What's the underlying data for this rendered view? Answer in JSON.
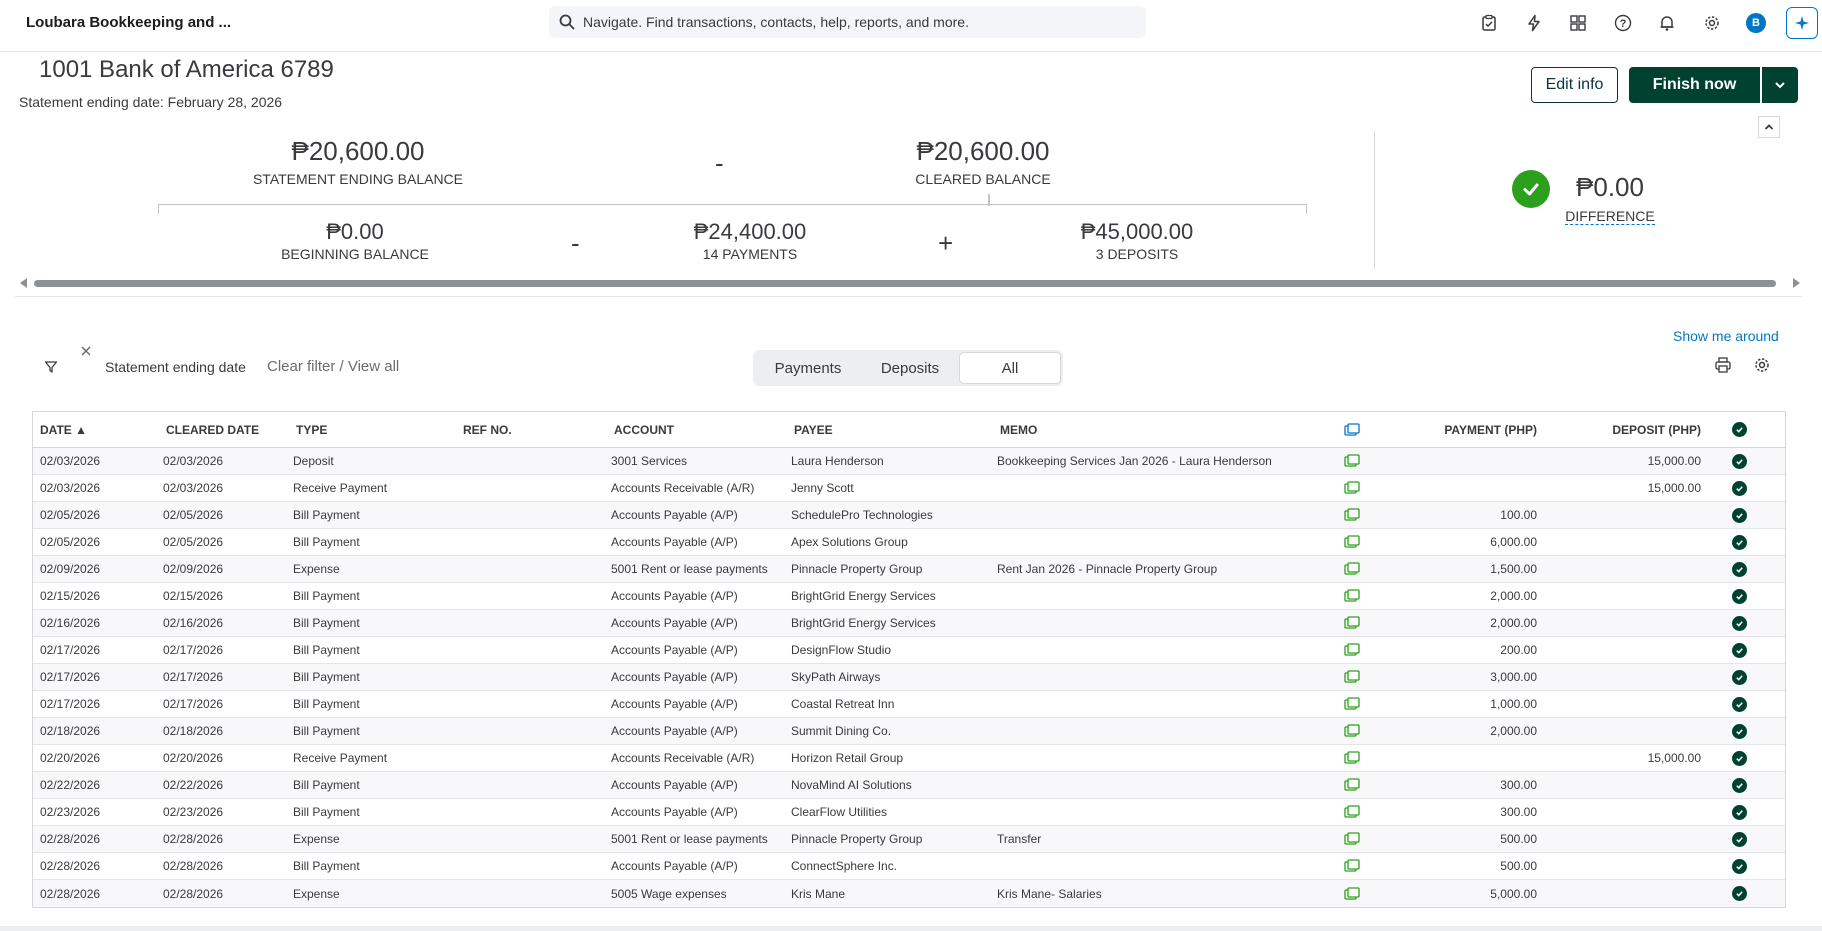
{
  "topbar": {
    "company": "Loubara Bookkeeping and ...",
    "search_placeholder": "Navigate. Find transactions, contacts, help, reports, and more.",
    "avatar_letter": "B"
  },
  "header": {
    "account_title": "1001 Bank of America 6789",
    "statement_date": "Statement ending date: February 28, 2026",
    "edit_label": "Edit info",
    "finish_label": "Finish now"
  },
  "summary": {
    "statement_ending_balance": "₱20,600.00",
    "statement_ending_label": "STATEMENT ENDING BALANCE",
    "minus": "-",
    "cleared_balance": "₱20,600.00",
    "cleared_label": "CLEARED BALANCE",
    "beginning_balance": "₱0.00",
    "beginning_label": "BEGINNING BALANCE",
    "payments_total": "₱24,400.00",
    "payments_label": "14 PAYMENTS",
    "plus": "+",
    "deposits_total": "₱45,000.00",
    "deposits_label": "3 DEPOSITS",
    "difference": "₱0.00",
    "difference_label": "DIFFERENCE",
    "check_color": "#2ca01c"
  },
  "filters": {
    "show_me_around": "Show me around",
    "chip_label": "Statement ending date",
    "clear_filter": "Clear filter / View all",
    "tabs": [
      "Payments",
      "Deposits",
      "All"
    ],
    "active_tab": "All"
  },
  "table": {
    "headers": {
      "date": "DATE ▲",
      "cleared_date": "CLEARED DATE",
      "type": "TYPE",
      "ref": "REF NO.",
      "account": "ACCOUNT",
      "payee": "PAYEE",
      "memo": "MEMO",
      "payment": "PAYMENT (PHP)",
      "deposit": "DEPOSIT (PHP)"
    },
    "rows": [
      {
        "date": "02/03/2026",
        "cleared": "02/03/2026",
        "type": "Deposit",
        "ref": "",
        "account": "3001 Services",
        "payee": "Laura Henderson",
        "memo": "Bookkeeping Services Jan 2026 - Laura Henderson",
        "payment": "",
        "deposit": "15,000.00"
      },
      {
        "date": "02/03/2026",
        "cleared": "02/03/2026",
        "type": "Receive Payment",
        "ref": "",
        "account": "Accounts Receivable (A/R)",
        "payee": "Jenny Scott",
        "memo": "",
        "payment": "",
        "deposit": "15,000.00"
      },
      {
        "date": "02/05/2026",
        "cleared": "02/05/2026",
        "type": "Bill Payment",
        "ref": "",
        "account": "Accounts Payable (A/P)",
        "payee": "SchedulePro Technologies",
        "memo": "",
        "payment": "100.00",
        "deposit": ""
      },
      {
        "date": "02/05/2026",
        "cleared": "02/05/2026",
        "type": "Bill Payment",
        "ref": "",
        "account": "Accounts Payable (A/P)",
        "payee": "Apex Solutions Group",
        "memo": "",
        "payment": "6,000.00",
        "deposit": ""
      },
      {
        "date": "02/09/2026",
        "cleared": "02/09/2026",
        "type": "Expense",
        "ref": "",
        "account": "5001 Rent or lease payments",
        "payee": "Pinnacle Property Group",
        "memo": "Rent Jan 2026 - Pinnacle Property Group",
        "payment": "1,500.00",
        "deposit": ""
      },
      {
        "date": "02/15/2026",
        "cleared": "02/15/2026",
        "type": "Bill Payment",
        "ref": "",
        "account": "Accounts Payable (A/P)",
        "payee": "BrightGrid Energy Services",
        "memo": "",
        "payment": "2,000.00",
        "deposit": ""
      },
      {
        "date": "02/16/2026",
        "cleared": "02/16/2026",
        "type": "Bill Payment",
        "ref": "",
        "account": "Accounts Payable (A/P)",
        "payee": "BrightGrid Energy Services",
        "memo": "",
        "payment": "2,000.00",
        "deposit": ""
      },
      {
        "date": "02/17/2026",
        "cleared": "02/17/2026",
        "type": "Bill Payment",
        "ref": "",
        "account": "Accounts Payable (A/P)",
        "payee": "DesignFlow Studio",
        "memo": "",
        "payment": "200.00",
        "deposit": ""
      },
      {
        "date": "02/17/2026",
        "cleared": "02/17/2026",
        "type": "Bill Payment",
        "ref": "",
        "account": "Accounts Payable (A/P)",
        "payee": "SkyPath Airways",
        "memo": "",
        "payment": "3,000.00",
        "deposit": ""
      },
      {
        "date": "02/17/2026",
        "cleared": "02/17/2026",
        "type": "Bill Payment",
        "ref": "",
        "account": "Accounts Payable (A/P)",
        "payee": "Coastal Retreat Inn",
        "memo": "",
        "payment": "1,000.00",
        "deposit": ""
      },
      {
        "date": "02/18/2026",
        "cleared": "02/18/2026",
        "type": "Bill Payment",
        "ref": "",
        "account": "Accounts Payable (A/P)",
        "payee": "Summit Dining Co.",
        "memo": "",
        "payment": "2,000.00",
        "deposit": ""
      },
      {
        "date": "02/20/2026",
        "cleared": "02/20/2026",
        "type": "Receive Payment",
        "ref": "",
        "account": "Accounts Receivable (A/R)",
        "payee": "Horizon Retail Group",
        "memo": "",
        "payment": "",
        "deposit": "15,000.00"
      },
      {
        "date": "02/22/2026",
        "cleared": "02/22/2026",
        "type": "Bill Payment",
        "ref": "",
        "account": "Accounts Payable (A/P)",
        "payee": "NovaMind AI Solutions",
        "memo": "",
        "payment": "300.00",
        "deposit": ""
      },
      {
        "date": "02/23/2026",
        "cleared": "02/23/2026",
        "type": "Bill Payment",
        "ref": "",
        "account": "Accounts Payable (A/P)",
        "payee": "ClearFlow Utilities",
        "memo": "",
        "payment": "300.00",
        "deposit": ""
      },
      {
        "date": "02/28/2026",
        "cleared": "02/28/2026",
        "type": "Expense",
        "ref": "",
        "account": "5001 Rent or lease payments",
        "payee": "Pinnacle Property Group",
        "memo": "Transfer",
        "payment": "500.00",
        "deposit": ""
      },
      {
        "date": "02/28/2026",
        "cleared": "02/28/2026",
        "type": "Bill Payment",
        "ref": "",
        "account": "Accounts Payable (A/P)",
        "payee": "ConnectSphere Inc.",
        "memo": "",
        "payment": "500.00",
        "deposit": ""
      },
      {
        "date": "02/28/2026",
        "cleared": "02/28/2026",
        "type": "Expense",
        "ref": "",
        "account": "5005 Wage expenses",
        "payee": "Kris Mane",
        "memo": "Kris Mane- Salaries",
        "payment": "5,000.00",
        "deposit": ""
      }
    ]
  },
  "colors": {
    "primary_dark": "#00412f",
    "link": "#0077c5",
    "attachment_green": "#2ca01c"
  },
  "icons": [
    "search-icon",
    "task-icon",
    "lightning-icon",
    "apps-icon",
    "help-icon",
    "bell-icon",
    "gear-icon",
    "assistant-icon",
    "chevron-down-icon",
    "chevron-up-icon",
    "checkmark-icon",
    "filter-icon",
    "close-icon",
    "print-icon",
    "settings-icon",
    "attachment-icon",
    "cleared-check-icon"
  ]
}
